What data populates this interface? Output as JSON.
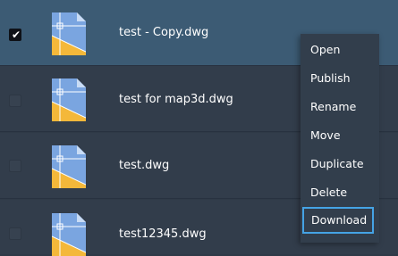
{
  "files": [
    {
      "name": "test - Copy.dwg",
      "selected": true,
      "icon": "dwg-file-icon"
    },
    {
      "name": "test for map3d.dwg",
      "selected": false,
      "icon": "dwg-file-icon"
    },
    {
      "name": "test.dwg",
      "selected": false,
      "icon": "dwg-file-icon"
    },
    {
      "name": "test12345.dwg",
      "selected": false,
      "icon": "dwg-file-icon"
    }
  ],
  "checkmark": "✔",
  "context_menu": {
    "items": [
      "Open",
      "Publish",
      "Rename",
      "Move",
      "Duplicate",
      "Delete",
      "Download"
    ],
    "focused_item": "Download"
  },
  "colors": {
    "accent": "#45a3e5",
    "selected_row": "#3c5b74",
    "row_bg": "#323d4b",
    "icon_blue": "#7aa5e0",
    "icon_yellow": "#f4b83a"
  }
}
